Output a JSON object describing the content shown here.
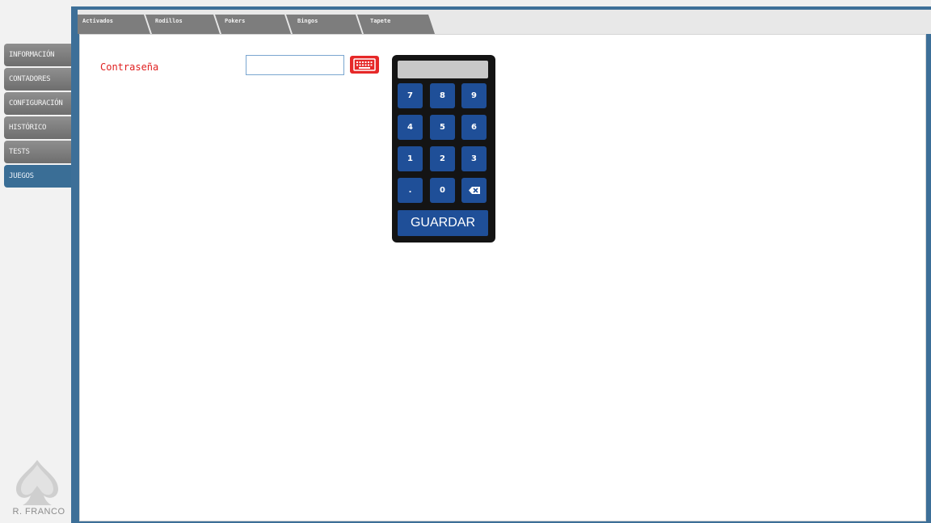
{
  "sidebar": {
    "items": [
      {
        "label": "INFORMACIÓN",
        "active": false
      },
      {
        "label": "CONTADORES",
        "active": false
      },
      {
        "label": "CONFIGURACIÓN",
        "active": false
      },
      {
        "label": "HISTÓRICO",
        "active": false
      },
      {
        "label": "TESTS",
        "active": false
      },
      {
        "label": "JUEGOS",
        "active": true
      }
    ],
    "logo_text": "R. FRANCO"
  },
  "tabs": [
    {
      "label": "Activados"
    },
    {
      "label": "Rodillos"
    },
    {
      "label": "Pokers"
    },
    {
      "label": "Bingos"
    },
    {
      "label": "Tapete"
    }
  ],
  "form": {
    "password_label": "Contraseña",
    "password_value": ""
  },
  "numpad": {
    "display_value": "",
    "keys": [
      "7",
      "8",
      "9",
      "4",
      "5",
      "6",
      "1",
      "2",
      "3",
      ".",
      "0"
    ],
    "save_label": "GUARDAR"
  },
  "colors": {
    "accent": "#3d6f98",
    "key_blue": "#1f4f98",
    "label_red": "#e02020",
    "keyboard_icon_red": "#e62828"
  }
}
